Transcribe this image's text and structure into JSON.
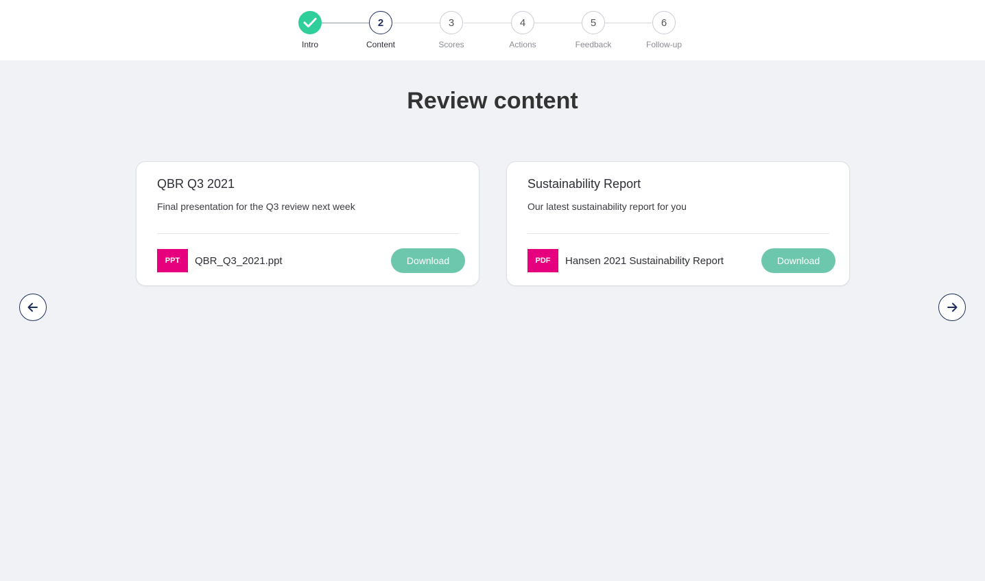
{
  "stepper": {
    "steps": [
      {
        "number": "1",
        "label": "Intro",
        "state": "done"
      },
      {
        "number": "2",
        "label": "Content",
        "state": "active"
      },
      {
        "number": "3",
        "label": "Scores",
        "state": "pending"
      },
      {
        "number": "4",
        "label": "Actions",
        "state": "pending"
      },
      {
        "number": "5",
        "label": "Feedback",
        "state": "pending"
      },
      {
        "number": "6",
        "label": "Follow-up",
        "state": "pending"
      }
    ],
    "colors": {
      "done": "#2fce9a",
      "active": "#1f2d5c"
    }
  },
  "page": {
    "title": "Review content"
  },
  "cards": [
    {
      "title": "QBR Q3 2021",
      "description": "Final presentation for the Q3 review next week",
      "file_type": "PPT",
      "file_name": "QBR_Q3_2021.ppt",
      "download_label": "Download"
    },
    {
      "title": "Sustainability Report",
      "description": "Our latest sustainability report for you",
      "file_type": "PDF",
      "file_name": "Hansen 2021 Sustainability Report",
      "download_label": "Download"
    }
  ],
  "navigation": {
    "prev_icon": "arrow-left-icon",
    "next_icon": "arrow-right-icon"
  },
  "colors": {
    "badge": "#e6007e",
    "download_button": "#6cc7ad",
    "nav_accent": "#1f2d5c"
  }
}
